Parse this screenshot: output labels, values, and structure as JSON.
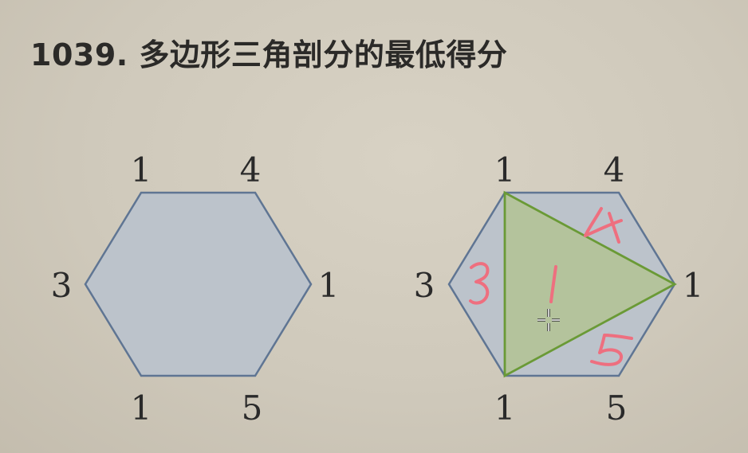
{
  "title": "1039. 多边形三角剖分的最低得分",
  "diagram": {
    "left": {
      "labels": {
        "top_left": "1",
        "top_right": "4",
        "right": "1",
        "bottom_right": "5",
        "bottom_left": "1",
        "left": "3"
      }
    },
    "right": {
      "labels": {
        "top_left": "1",
        "top_right": "4",
        "right": "1",
        "bottom_right": "5",
        "bottom_left": "1",
        "left": "3"
      },
      "highlighted_triangle": [
        "top_left",
        "right",
        "bottom_left"
      ]
    }
  },
  "colors": {
    "hexagon_fill": "#bcc3cb",
    "hexagon_stroke": "#5f7593",
    "triangle_fill": "#b3c394",
    "triangle_stroke": "#6a9a36",
    "handwriting": "#ee6f7f"
  },
  "icons": {
    "cursor": "crosshair-move-cursor-icon"
  }
}
